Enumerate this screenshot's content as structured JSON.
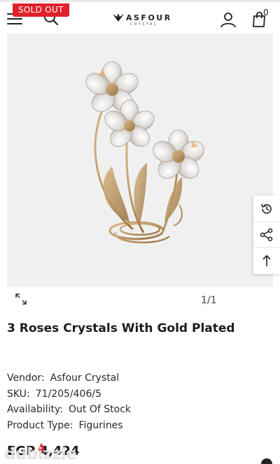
{
  "header": {
    "badge": "SOLD OUT",
    "logo_name": "ASFOUR",
    "logo_sub": "CRYSTAL",
    "cart_count": "0",
    "icons": [
      "menu-icon",
      "search-icon",
      "account-icon",
      "cart-icon"
    ]
  },
  "gallery": {
    "pager": "1/1",
    "icons": [
      "expand-icon",
      "history-icon",
      "share-icon",
      "arrow-up-icon"
    ]
  },
  "product": {
    "title": "3 Roses Crystals With Gold Plated",
    "details": [
      {
        "label": "Vendor:",
        "value": "Asfour Crystal"
      },
      {
        "label": "SKU:",
        "value": "71/205/406/5"
      },
      {
        "label": "Availability:",
        "value": "Out Of Stock"
      },
      {
        "label": "Product Type:",
        "value": "Figurines"
      }
    ],
    "price": "EGP 4,424"
  },
  "watermark": "dubizzle",
  "colors": {
    "badge": "#e0202a",
    "image_background": "#f0f0f0",
    "gold": "#b8925a"
  }
}
